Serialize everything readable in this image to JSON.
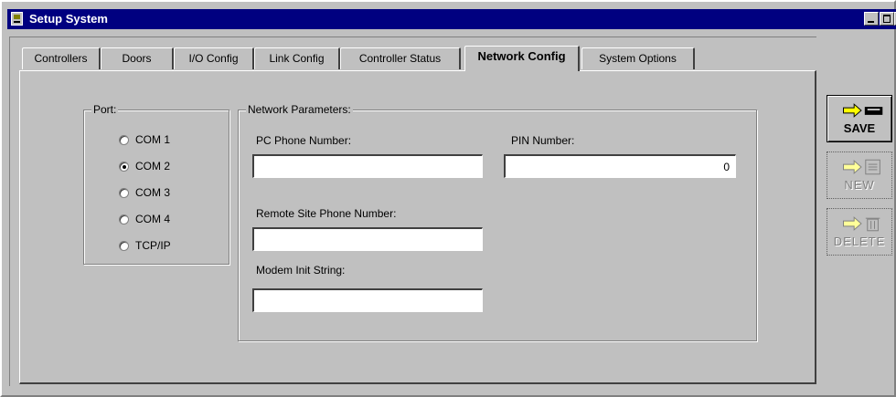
{
  "window": {
    "title": "Setup System"
  },
  "tabs": [
    {
      "label": "Controllers",
      "active": false
    },
    {
      "label": "Doors",
      "active": false
    },
    {
      "label": "I/O Config",
      "active": false
    },
    {
      "label": "Link Config",
      "active": false
    },
    {
      "label": "Controller Status",
      "active": false
    },
    {
      "label": "Network Config",
      "active": true
    },
    {
      "label": "System Options",
      "active": false
    }
  ],
  "port_group": {
    "legend": "Port:",
    "options": [
      {
        "label": "COM 1",
        "selected": false
      },
      {
        "label": "COM 2",
        "selected": true
      },
      {
        "label": "COM 3",
        "selected": false
      },
      {
        "label": "COM 4",
        "selected": false
      },
      {
        "label": "TCP/IP",
        "selected": false
      }
    ]
  },
  "network_group": {
    "legend": "Network Parameters:",
    "pc_phone": {
      "label": "PC Phone Number:",
      "value": ""
    },
    "pin": {
      "label": "PIN Number:",
      "value": "0"
    },
    "remote_phone": {
      "label": "Remote Site Phone Number:",
      "value": ""
    },
    "modem_init": {
      "label": "Modem Init String:",
      "value": ""
    }
  },
  "side_buttons": {
    "save": {
      "label": "SAVE",
      "enabled": true,
      "icon": "arrow-disk-icon"
    },
    "new": {
      "label": "NEW",
      "enabled": false,
      "icon": "arrow-document-icon"
    },
    "delete": {
      "label": "DELETE",
      "enabled": false,
      "icon": "arrow-trash-icon"
    }
  },
  "colors": {
    "titlebar": "#000080",
    "face": "#c0c0c0",
    "arrow": "#ffff00"
  }
}
